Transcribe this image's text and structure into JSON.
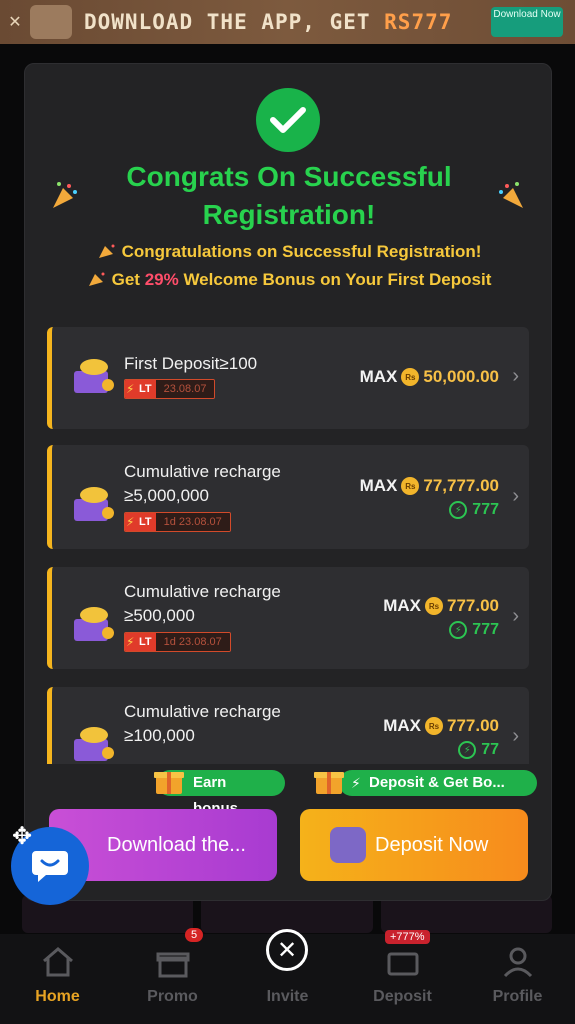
{
  "banner": {
    "text_prefix": "DOWNLOAD THE APP, GET ",
    "amount": "RS777",
    "download_button": "Download Now"
  },
  "modal": {
    "title": "Congrats On Successful Registration!",
    "subline_1": "Congratulations on Successful Registration!",
    "subline_2_prefix": "Get ",
    "subline_2_pct": "29%",
    "subline_2_suffix": " Welcome Bonus on Your First Deposit",
    "cards": [
      {
        "name": "First Deposit≥100",
        "tag": "LT",
        "date": "23.08.07",
        "max_label": "MAX",
        "coin": "Rs",
        "max_value": "50,000.00",
        "bonus": ""
      },
      {
        "name_line1": "Cumulative recharge",
        "name_line2": "≥5,000,000",
        "tag": "LT",
        "date": "1d 23.08.07",
        "max_label": "MAX",
        "coin": "Rs",
        "max_value": "77,777.00",
        "bonus": "777"
      },
      {
        "name_line1": "Cumulative recharge",
        "name_line2": "≥500,000",
        "tag": "LT",
        "date": "1d 23.08.07",
        "max_label": "MAX",
        "coin": "Rs",
        "max_value": "777.00",
        "bonus": "777"
      },
      {
        "name_line1": "Cumulative recharge",
        "name_line2": "≥100,000",
        "max_label": "MAX",
        "coin": "Rs",
        "max_value": "777.00",
        "bonus": "77"
      }
    ],
    "earn_pill": "Earn bonus",
    "deposit_pill": "Deposit & Get Bo...",
    "download_button": "Download the...",
    "deposit_button": "Deposit Now"
  },
  "bottom_nav": {
    "items": [
      {
        "label": "Home",
        "icon": "home-icon",
        "active": true
      },
      {
        "label": "Promo",
        "icon": "gift-icon",
        "badge": "5"
      },
      {
        "label": "Invite",
        "icon": "invite-icon"
      },
      {
        "label": "Deposit",
        "icon": "wallet-icon",
        "badge": "+777%"
      },
      {
        "label": "Profile",
        "icon": "profile-icon"
      }
    ]
  },
  "colors": {
    "accent_green": "#28d24e",
    "accent_gold": "#f6c83c",
    "nav_active": "#e7a323"
  }
}
